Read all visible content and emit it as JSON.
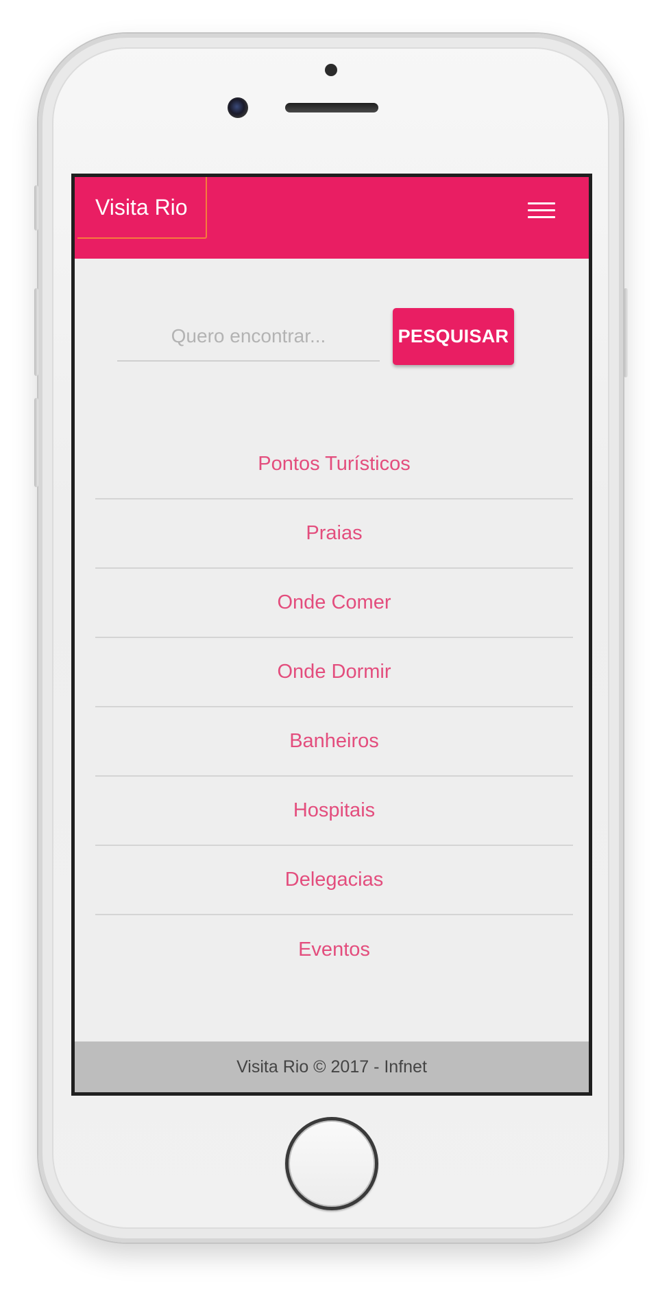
{
  "navbar": {
    "brand": "Visita Rio",
    "menu_icon": "hamburger-menu-icon"
  },
  "search": {
    "placeholder": "Quero encontrar...",
    "value": "",
    "button_label": "PESQUISAR"
  },
  "menu": {
    "items": [
      {
        "label": "Pontos Turísticos"
      },
      {
        "label": "Praias"
      },
      {
        "label": "Onde Comer"
      },
      {
        "label": "Onde Dormir"
      },
      {
        "label": "Banheiros"
      },
      {
        "label": "Hospitais"
      },
      {
        "label": "Delegacias"
      },
      {
        "label": "Eventos"
      }
    ]
  },
  "footer": {
    "text": "Visita Rio © 2017 - Infnet"
  },
  "colors": {
    "primary": "#e91e63",
    "link": "#e34d7d",
    "background": "#eeeeee",
    "footer": "#bdbdbd"
  }
}
